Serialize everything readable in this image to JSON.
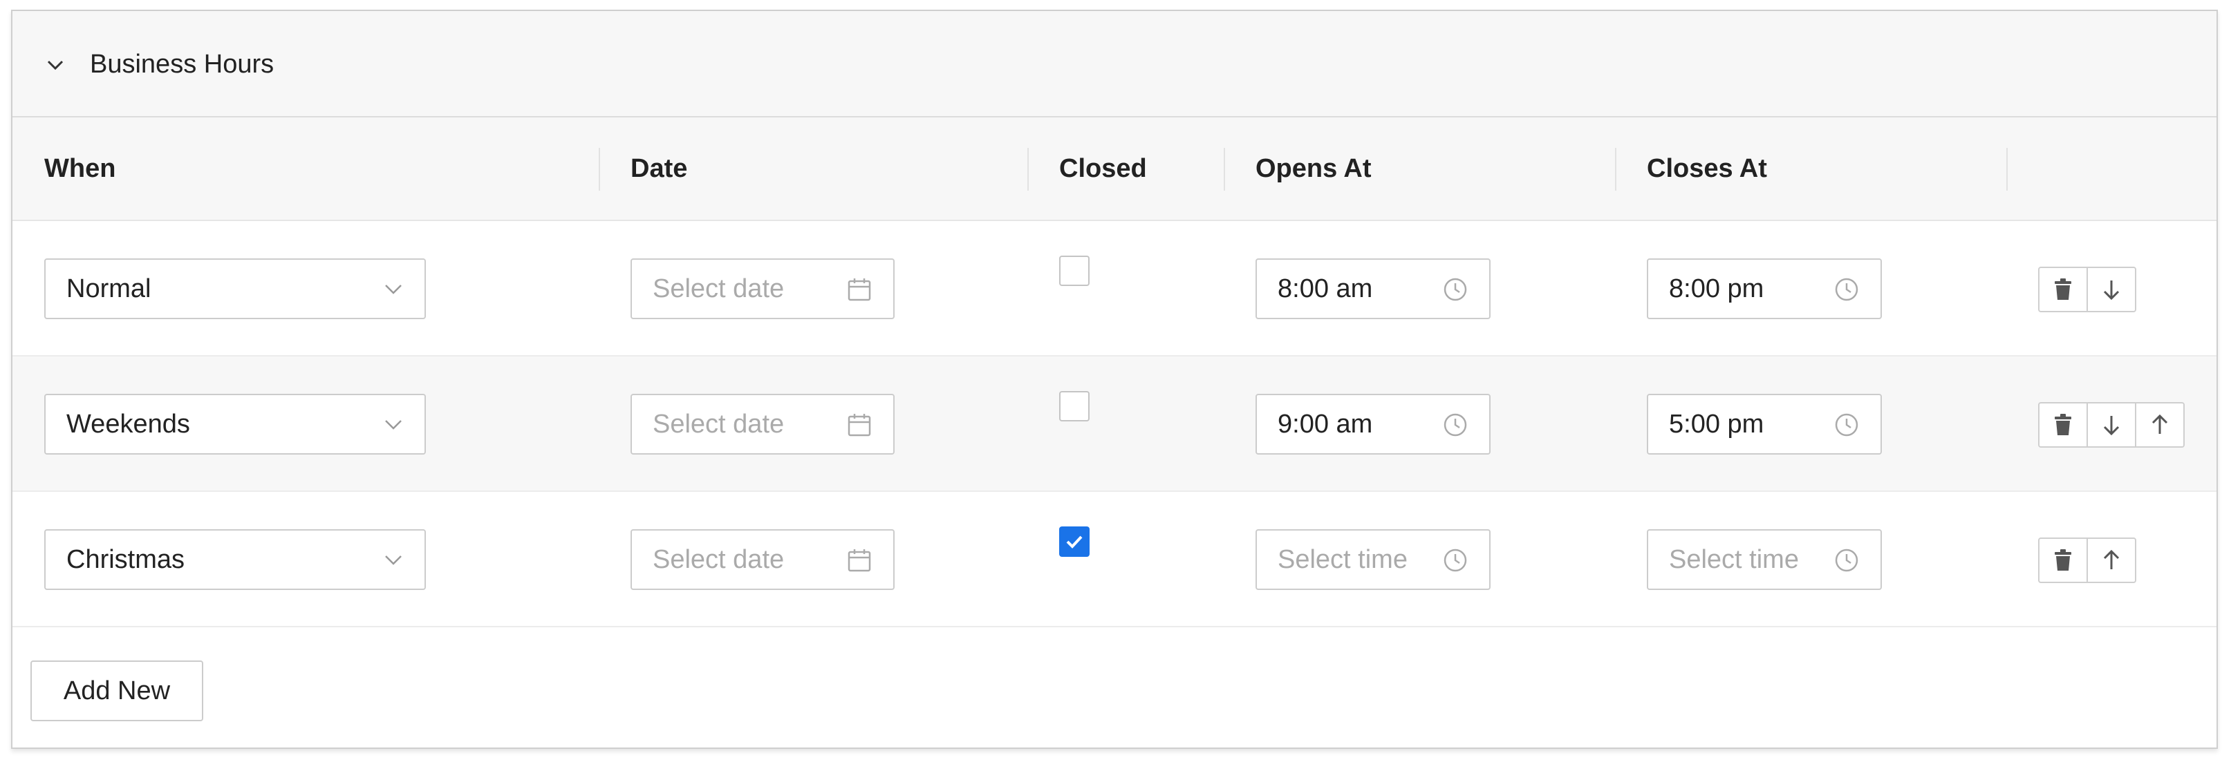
{
  "panel": {
    "title": "Business Hours"
  },
  "columns": {
    "when": "When",
    "date": "Date",
    "closed": "Closed",
    "opens": "Opens At",
    "closes": "Closes At"
  },
  "rows": [
    {
      "when": "Normal",
      "date_placeholder": "Select date",
      "closed": false,
      "opens": "8:00 am",
      "closes": "8:00 pm",
      "actions": [
        "trash-icon",
        "arrow-down-icon"
      ]
    },
    {
      "when": "Weekends",
      "date_placeholder": "Select date",
      "closed": false,
      "opens": "9:00 am",
      "closes": "5:00 pm",
      "actions": [
        "trash-icon",
        "arrow-down-icon",
        "arrow-up-icon"
      ]
    },
    {
      "when": "Christmas",
      "date_placeholder": "Select date",
      "closed": true,
      "opens_placeholder": "Select time",
      "closes_placeholder": "Select time",
      "actions": [
        "trash-icon",
        "arrow-up-icon"
      ]
    }
  ],
  "add_button_label": "Add New",
  "colors": {
    "accent": "#1a73e8",
    "header_bg": "#f7f7f7",
    "border": "#cccccc",
    "placeholder": "#aaaaaa"
  }
}
